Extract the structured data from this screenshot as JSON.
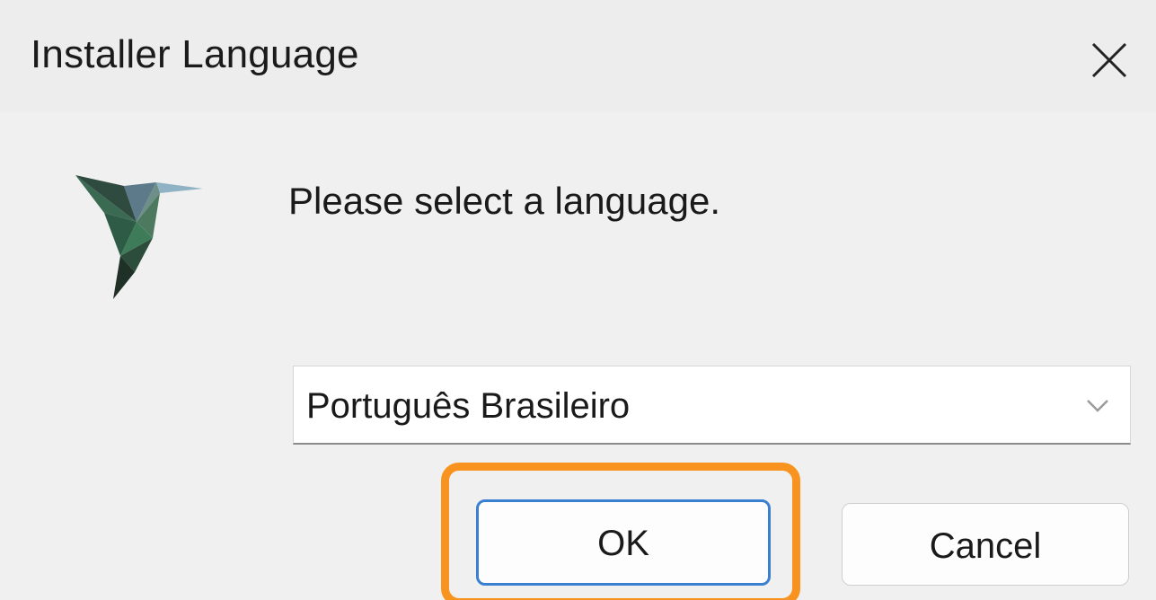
{
  "window": {
    "title": "Installer Language",
    "close_icon": "close-icon"
  },
  "dialog": {
    "logo_icon": "hummingbird-logo-icon",
    "prompt": "Please select a language.",
    "language_select": {
      "selected": "Português Brasileiro",
      "icon": "chevron-down-icon"
    },
    "buttons": {
      "ok_label": "OK",
      "cancel_label": "Cancel"
    }
  },
  "colors": {
    "highlight": "#f7931e",
    "focus_border": "#3a7fd0"
  }
}
